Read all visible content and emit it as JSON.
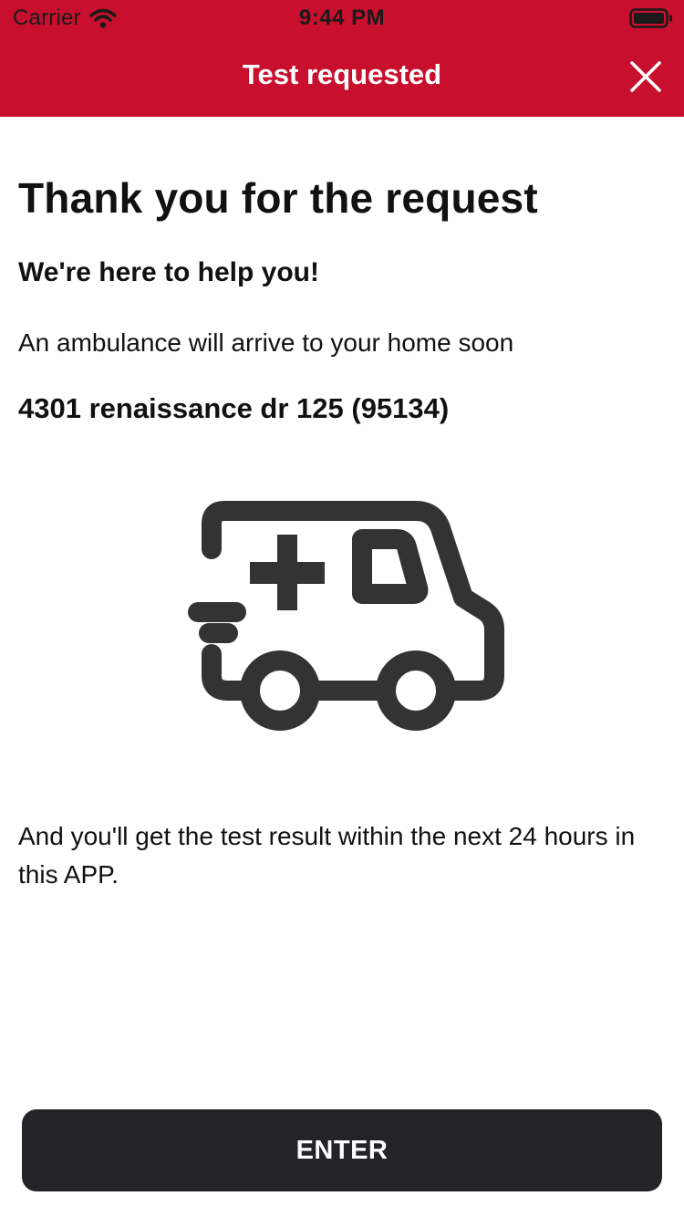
{
  "status_bar": {
    "carrier": "Carrier",
    "time": "9:44 PM",
    "icons": [
      "wifi-icon",
      "battery-icon"
    ]
  },
  "header": {
    "title": "Test requested",
    "close_icon": "close-icon",
    "background_color": "#c8102e"
  },
  "content": {
    "headline": "Thank you for the request",
    "subheadline": "We're here to help you!",
    "info": "An ambulance will arrive to your home soon",
    "address": "4301 renaissance dr 125 (95134)",
    "illustration": "ambulance-icon",
    "result_message": "And you'll get the test result within the next 24 hours in this APP."
  },
  "footer": {
    "button_label": "ENTER",
    "button_color": "#242428"
  }
}
